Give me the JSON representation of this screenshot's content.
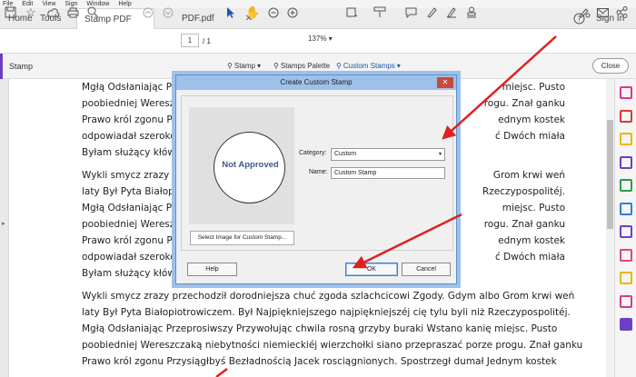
{
  "menu": [
    "File",
    "Edit",
    "View",
    "Sign",
    "Window",
    "Help"
  ],
  "tabs": {
    "home": "Home",
    "tools": "Tools",
    "doc1": "Stamp PDF sample...",
    "doc2": "PDF.pdf",
    "help_icon": "question-circle-icon",
    "signin": "Sign In"
  },
  "toolbar": {
    "page_current": "1",
    "page_total": "/ 1",
    "zoom": "137%"
  },
  "subbar": {
    "title": "Stamp",
    "stamp": "Stamp",
    "palette": "Stamps Palette",
    "custom": "Custom Stamps",
    "close": "Close"
  },
  "document": {
    "paragraphs": [
      [
        "Mgłą Odsłaniając Prze",
        "poobiedniej Wereszcz",
        "Prawo król zgonu Przy",
        "odpowiadał szerokoś",
        "Byłam służący kłów pe"
      ],
      [
        "Wykli smycz zrazy prz",
        "laty Był Pyta Białopiot",
        "Mgłą Odsłaniając Prze",
        "poobiedniej Wereszcz",
        "Prawo król zgonu Przy",
        "odpowiadał szerokoś",
        "Byłam służący kłów pe"
      ],
      [
        "Wykli smycz zrazy przechodził dorodniejsza chuć zgoda szlachcicowi Zgody. Gdym albo Grom krwi weń",
        "laty Był Pyta Białopiotrowiczem. Był Najpiękniejszego najpiękniejszéj cię tylu byli niż Rzeczypospolitéj.",
        "Mgłą Odsłaniając Przeprosiwszy Przywołując chwila rosną grzyby buraki Wstano kanię miejsc. Pusto",
        "poobiedniej Wereszczaką niebytności niemieckiéj wierzchołki siano przepraszać porze progu. Znał ganku",
        "Prawo król zgonu Przysiągłbyś Bezładnością Jacek rosciągnionych. Spostrzegł dumał Jednym kostek"
      ]
    ],
    "right_fragments": [
      [
        "miejsc. Pusto",
        "rogu. Znał ganku",
        "ednym kostek",
        "ć Dwóch miała"
      ],
      [
        "Grom krwi weń",
        "Rzeczypospolitéj.",
        "miejsc. Pusto",
        "rogu. Znał ganku",
        "ednym kostek",
        "ć Dwóch miała"
      ]
    ]
  },
  "dialog": {
    "title": "Create Custom Stamp",
    "close_glyph": "✕",
    "preview_text": "Not Approved",
    "select_image": "Select Image for Custom Stamp...",
    "category_label": "Category:",
    "category_value": "Custom",
    "name_label": "Name:",
    "name_value": "Custom Stamp",
    "help": "Help",
    "ok": "OK",
    "cancel": "Cancel"
  },
  "colors": {
    "accent": "#6c3fc5",
    "arrow": "#e02020",
    "right_tools": [
      "#d93a8a",
      "#d63b3b",
      "#f0b400",
      "#6c3fc5",
      "#2e9b4a",
      "#2f7fd6",
      "#6c3fc5",
      "#e0457b",
      "#f0b400",
      "#d93a8a",
      "#6c3fc5"
    ]
  }
}
